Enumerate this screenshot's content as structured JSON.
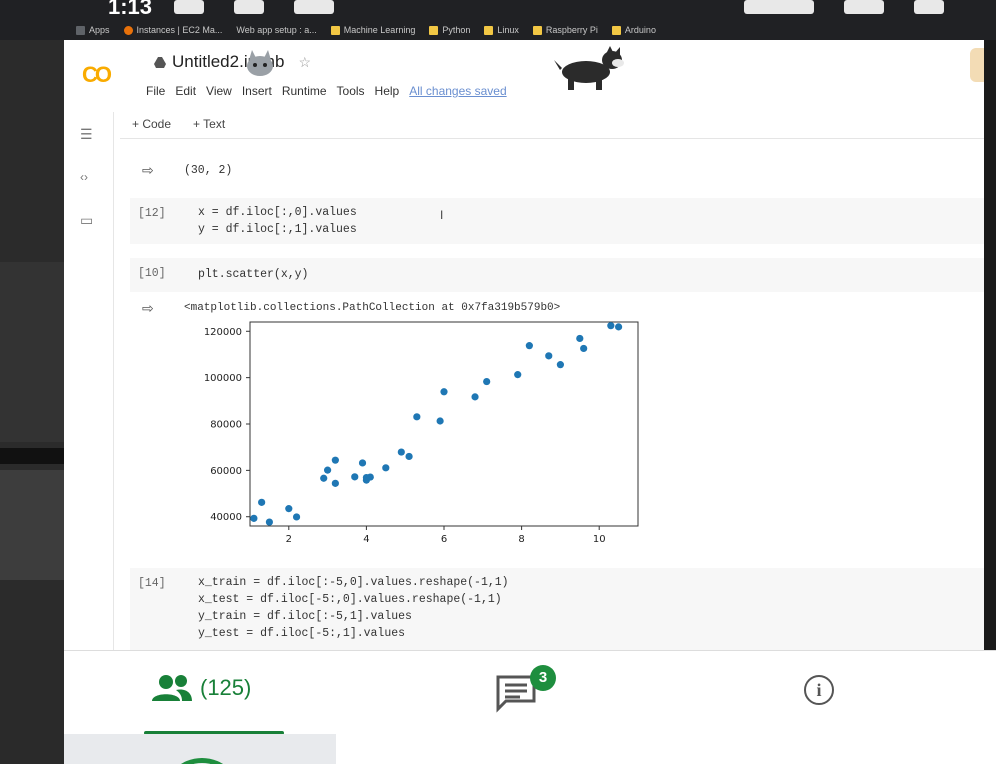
{
  "status": {
    "time": "1:13"
  },
  "bookmarks": [
    "Apps",
    "Instances | EC2 Ma...",
    "Web app setup : a...",
    "Machine Learning",
    "Python",
    "Linux",
    "Raspberry Pi",
    "Arduino"
  ],
  "colab": {
    "logo": "CO",
    "title": "Untitled2.ipynb",
    "menu": [
      "File",
      "Edit",
      "View",
      "Insert",
      "Runtime",
      "Tools",
      "Help"
    ],
    "saved_label": "All changes saved",
    "toolbar": {
      "add_code": "+ Code",
      "add_text": "+ Text"
    }
  },
  "cells": {
    "shape_output": "(30, 2)",
    "cell12": {
      "prompt": "[12]",
      "code": "x = df.iloc[:,0].values\ny = df.iloc[:,1].values"
    },
    "cell10": {
      "prompt": "[10]",
      "code": "plt.scatter(x,y)",
      "output": "<matplotlib.collections.PathCollection at 0x7fa319b579b0>"
    },
    "cell14": {
      "prompt": "[14]",
      "code": "x_train = df.iloc[:-5,0].values.reshape(-1,1)\nx_test = df.iloc[-5:,0].values.reshape(-1,1)\ny_train = df.iloc[:-5,1].values\ny_test = df.iloc[-5:,1].values"
    }
  },
  "chart_data": {
    "type": "scatter",
    "xlim": [
      1.0,
      11.0
    ],
    "ylim": [
      36000,
      124000
    ],
    "xticks": [
      2,
      4,
      6,
      8,
      10
    ],
    "yticks": [
      40000,
      60000,
      80000,
      100000,
      120000
    ],
    "ytick_labels": [
      "40000",
      "60000",
      "80000",
      "100000",
      "120000"
    ],
    "grid": false,
    "series": [
      {
        "color": "#1f77b4",
        "points": [
          [
            1.1,
            39300
          ],
          [
            1.3,
            46200
          ],
          [
            1.5,
            37700
          ],
          [
            2.0,
            43500
          ],
          [
            2.2,
            39900
          ],
          [
            2.9,
            56600
          ],
          [
            3.0,
            60100
          ],
          [
            3.2,
            54400
          ],
          [
            3.2,
            64400
          ],
          [
            3.7,
            57200
          ],
          [
            3.9,
            63200
          ],
          [
            4.0,
            55800
          ],
          [
            4.0,
            56900
          ],
          [
            4.1,
            57100
          ],
          [
            4.5,
            61100
          ],
          [
            4.9,
            67900
          ],
          [
            5.1,
            66000
          ],
          [
            5.3,
            83100
          ],
          [
            5.9,
            81300
          ],
          [
            6.0,
            93900
          ],
          [
            6.8,
            91700
          ],
          [
            7.1,
            98300
          ],
          [
            7.9,
            101300
          ],
          [
            8.2,
            113800
          ],
          [
            8.7,
            109400
          ],
          [
            9.0,
            105600
          ],
          [
            9.5,
            116900
          ],
          [
            9.6,
            112600
          ],
          [
            10.3,
            122400
          ],
          [
            10.5,
            121900
          ]
        ]
      }
    ]
  },
  "bottom": {
    "participants": "(125)",
    "chat_badge": "3",
    "info_glyph": "i"
  }
}
